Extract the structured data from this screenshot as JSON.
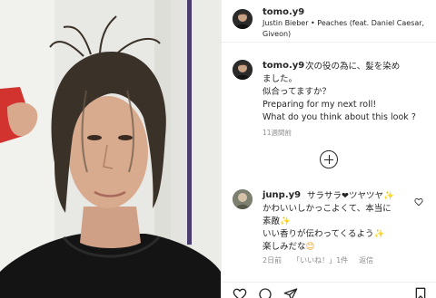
{
  "header": {
    "username": "tomo.y9",
    "song": "Justin Bieber • Peaches (feat. Daniel Caesar, Giveon)"
  },
  "caption": {
    "username": "tomo.y9",
    "line1": "次の役の為に、髪を染め",
    "line2": "ました。",
    "line3": "似合ってますか？",
    "line4": "Preparing for my next roll!",
    "line5": "What do you think about this look ?",
    "time": "11週間前"
  },
  "comment": {
    "username": "junp.y9",
    "line1_a": "サラサラ",
    "heart": "❤",
    "line1_b": "ツヤツヤ",
    "spark": "✨",
    "line2": "かわいいしかっこよくて、本当に",
    "line3": "素敵",
    "line4": "いい香りが伝わってくるよう",
    "line5": "楽しみだな",
    "smile": "😊",
    "time": "2日前",
    "likes": "「いいね！」1件",
    "reply": "返信"
  },
  "icons": {
    "plus": "plus-circle-icon",
    "heart": "heart-icon",
    "comment": "comment-icon",
    "share": "share-icon",
    "save": "bookmark-icon"
  },
  "colors": {
    "text": "#262626",
    "muted": "#8e8e8e",
    "divider": "#efefef"
  }
}
